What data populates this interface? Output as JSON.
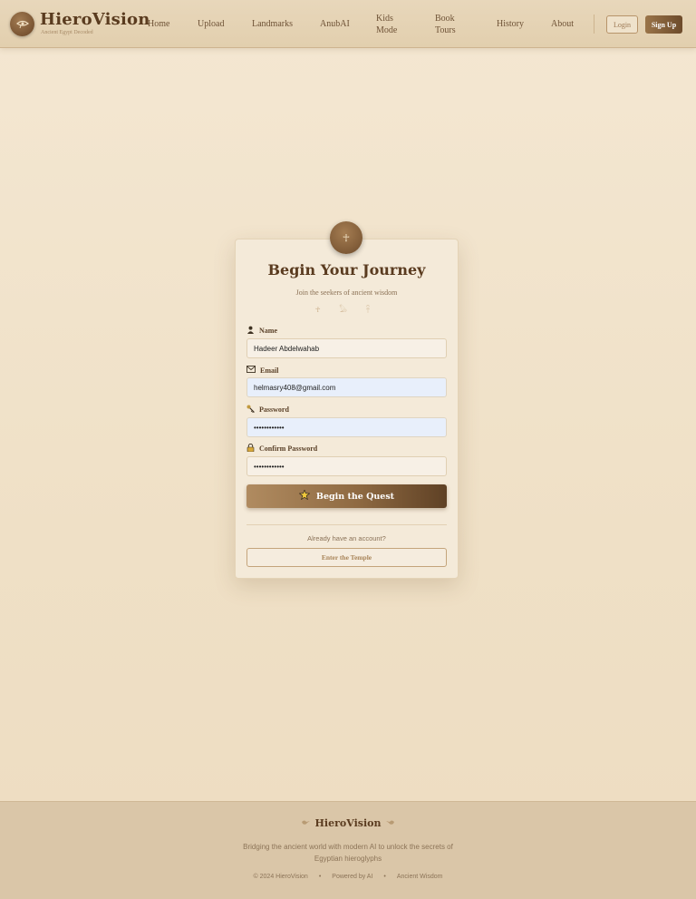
{
  "header": {
    "brand": "HieroVision",
    "tagline": "Ancient Egypt Decoded",
    "nav": [
      {
        "label": "Home"
      },
      {
        "label": "Upload"
      },
      {
        "label": "Landmarks"
      },
      {
        "label": "AnubAI"
      },
      {
        "label": "Kids\nMode"
      },
      {
        "label": "Book\nTours"
      },
      {
        "label": "History"
      },
      {
        "label": "About"
      }
    ],
    "login_label": "Login",
    "signup_label": "Sign Up"
  },
  "form": {
    "badge_icon": "☥",
    "title": "Begin Your Journey",
    "subtitle": "Join the seekers of ancient wisdom",
    "glyphs": "☥ 𓅃 𓋹",
    "fields": {
      "name": {
        "label": "Name",
        "icon": "person-icon",
        "value": "Hadeer Abdelwahab"
      },
      "email": {
        "label": "Email",
        "icon": "envelope-icon",
        "value": "helmasry408@gmail.com"
      },
      "password": {
        "label": "Password",
        "icon": "key-icon",
        "value": "••••••••••••"
      },
      "confirm": {
        "label": "Confirm Password",
        "icon": "lock-icon",
        "value": "••••••••••••"
      }
    },
    "submit_label": "Begin the Quest",
    "already_text": "Already have an account?",
    "login_link_label": "Enter the Temple"
  },
  "footer": {
    "brand": "HieroVision",
    "description": "Bridging the ancient world with modern AI to unlock the secrets of Egyptian hieroglyphs",
    "copyright": "© 2024 HieroVision",
    "powered": "Powered by AI",
    "wisdom": "Ancient Wisdom",
    "separator": "•"
  },
  "colors": {
    "accent": "#6d4b2b",
    "background": "#f4e7d2",
    "footer": "#dac6a8"
  }
}
